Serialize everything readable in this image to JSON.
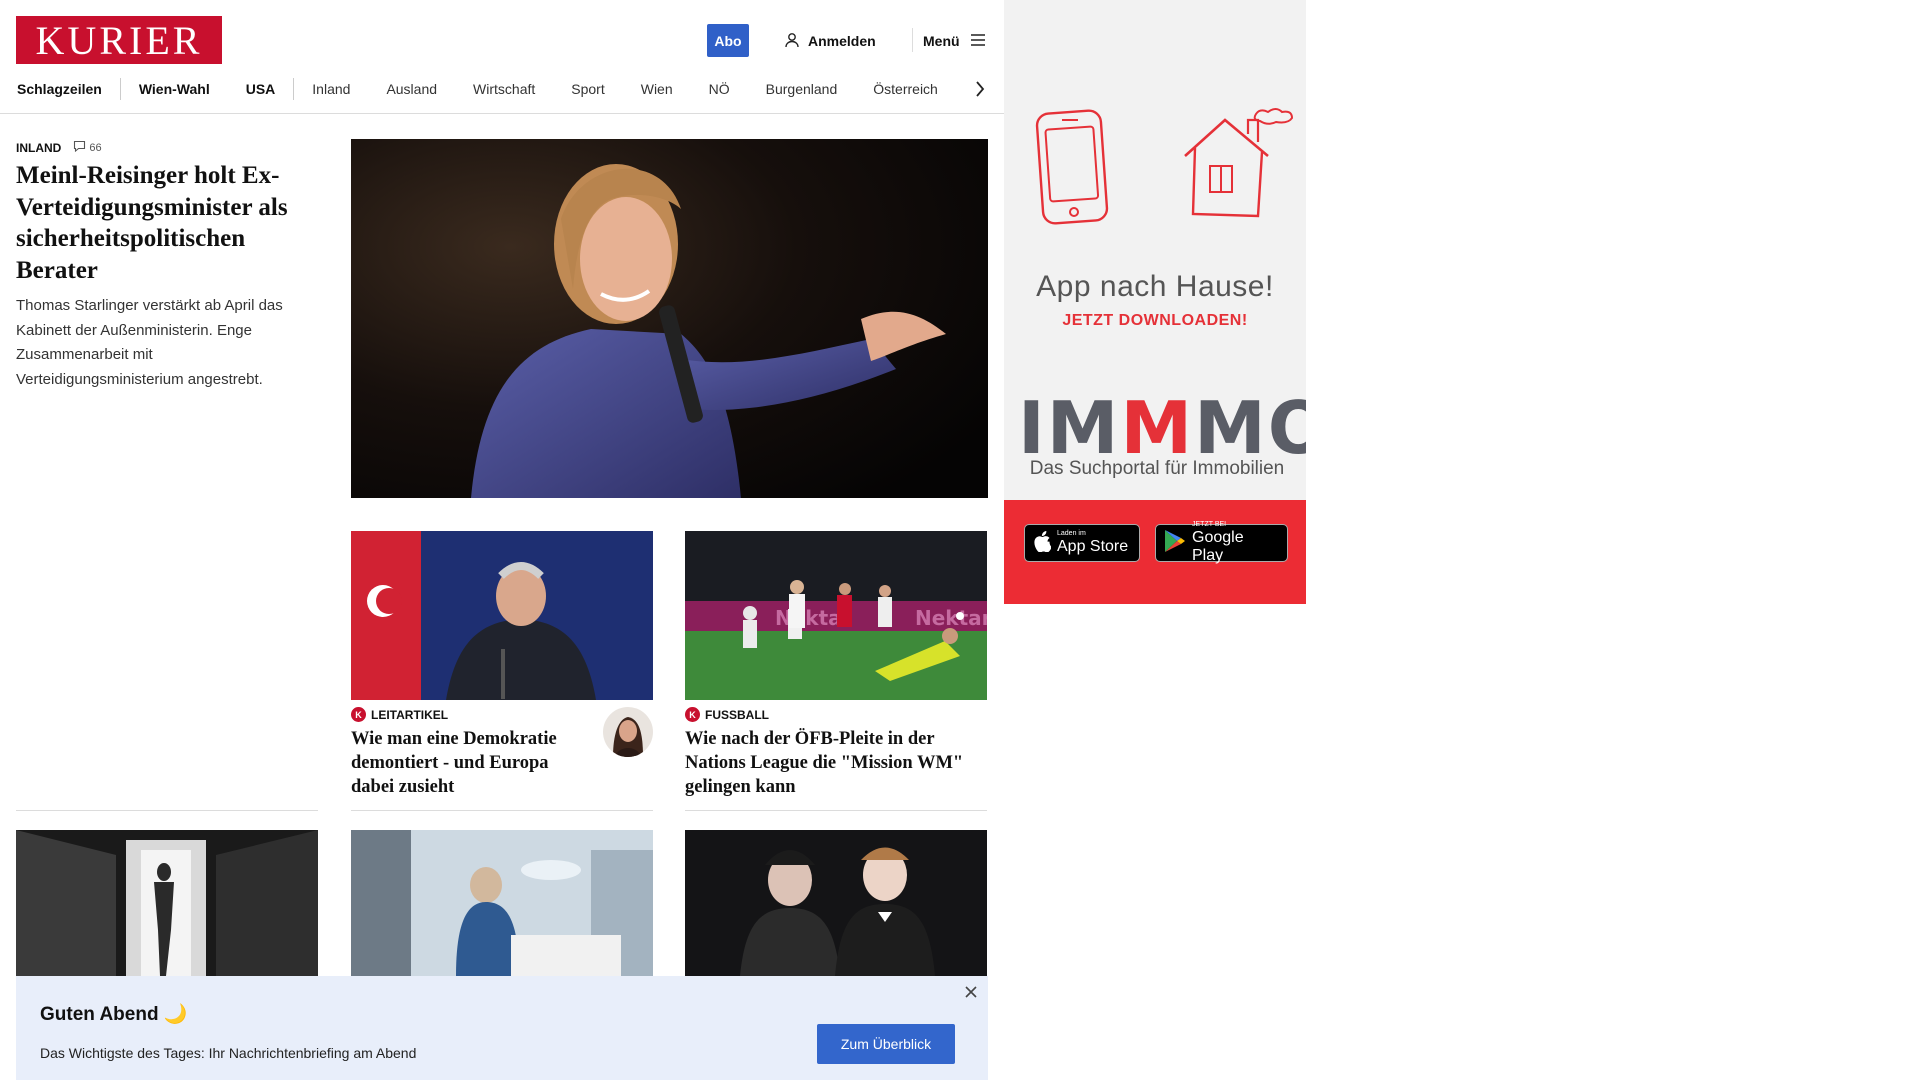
{
  "header": {
    "logo": "KURIER",
    "abo_label": "Abo",
    "login_label": "Anmelden",
    "menu_label": "Menü"
  },
  "nav": {
    "items": [
      "Schlagzeilen",
      "Wien-Wahl",
      "USA",
      "Inland",
      "Ausland",
      "Wirtschaft",
      "Sport",
      "Wien",
      "NÖ",
      "Burgenland",
      "Österreich"
    ]
  },
  "lead": {
    "category": "INLAND",
    "comments": "66",
    "title": "Meinl-Reisinger holt Ex-Verteidigungsminister als sicherheitspolitischen Berater",
    "teaser": "Thomas Starlinger verstärkt ab April das Kabinett der Außenministerin. Enge Zusammenarbeit mit Verteidigungsministerium angestrebt."
  },
  "cards": [
    {
      "badge": "K",
      "category": "LEITARTIKEL",
      "title": "Wie man eine Demokratie demontiert - und Europa dabei zusieht"
    },
    {
      "badge": "K",
      "category": "FUSSBALL",
      "title": "Wie nach der ÖFB-Pleite in der Nations League die \"Mission WM\" gelingen kann"
    }
  ],
  "ad": {
    "headline": "App nach Hause!",
    "sub": "JETZT DOWNLOADEN!",
    "brand_a": "IM",
    "brand_m": "M",
    "brand_b": "MO",
    "tagline": "Das Suchportal für Immobilien",
    "appstore_small": "Laden im",
    "appstore_big": "App Store",
    "googleplay_small": "JETZT BEI",
    "googleplay_big": "Google Play"
  },
  "banner": {
    "title": "Guten Abend 🌙",
    "text": "Das Wichtigste des Tages: Ihr Nachrichtenbriefing am Abend",
    "button": "Zum Überblick"
  },
  "colors": {
    "brand_red": "#c8102e",
    "accent_blue": "#3366cc",
    "ad_red": "#ec2c34"
  }
}
